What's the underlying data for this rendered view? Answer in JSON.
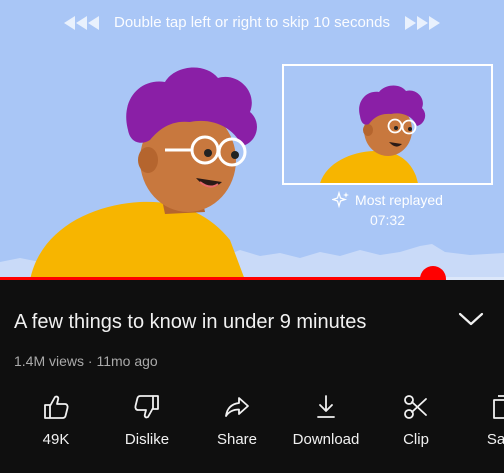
{
  "player": {
    "skip_hint": "Double tap left or right to skip 10 seconds",
    "most_replayed_label": "Most replayed",
    "most_replayed_time": "07:32",
    "progress": 0.86,
    "accent_color": "#ff0000"
  },
  "video": {
    "title": "A few things to know in under 9 minutes",
    "meta": "1.4M views · 11mo ago"
  },
  "actions": [
    {
      "label": "49K",
      "icon": "thumbs-up-icon"
    },
    {
      "label": "Dislike",
      "icon": "thumbs-down-icon"
    },
    {
      "label": "Share",
      "icon": "share-icon"
    },
    {
      "label": "Download",
      "icon": "download-icon"
    },
    {
      "label": "Clip",
      "icon": "scissors-icon"
    },
    {
      "label": "Save",
      "icon": "save-icon"
    }
  ]
}
